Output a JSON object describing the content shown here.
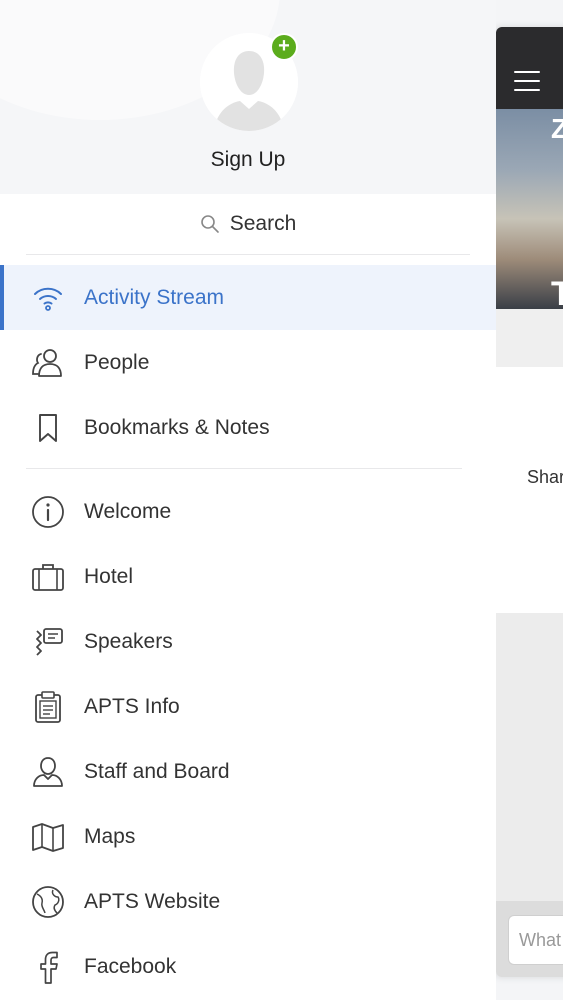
{
  "profile": {
    "sign_up_label": "Sign Up",
    "plus_symbol": "+"
  },
  "search": {
    "label": "Search"
  },
  "menu_primary": [
    {
      "label": "Activity Stream",
      "icon": "wifi-icon",
      "active": true
    },
    {
      "label": "People",
      "icon": "people-icon",
      "active": false
    },
    {
      "label": "Bookmarks & Notes",
      "icon": "bookmark-icon",
      "active": false
    }
  ],
  "menu_secondary": [
    {
      "label": "Welcome",
      "icon": "info-icon"
    },
    {
      "label": "Hotel",
      "icon": "briefcase-icon"
    },
    {
      "label": "Speakers",
      "icon": "speaker-icon"
    },
    {
      "label": "APTS Info",
      "icon": "clipboard-icon"
    },
    {
      "label": "Staff and Board",
      "icon": "person-icon"
    },
    {
      "label": "Maps",
      "icon": "map-icon"
    },
    {
      "label": "APTS Website",
      "icon": "globe-icon"
    },
    {
      "label": "Facebook",
      "icon": "facebook-icon"
    }
  ],
  "main_peek": {
    "share_text": "Shar",
    "composer_placeholder": "What",
    "hero_glyph_top": "Z",
    "hero_glyph_bottom": "T"
  },
  "colors": {
    "accent": "#3b73c9",
    "badge_green": "#5bac1c",
    "topbar": "#2b2b2d"
  }
}
